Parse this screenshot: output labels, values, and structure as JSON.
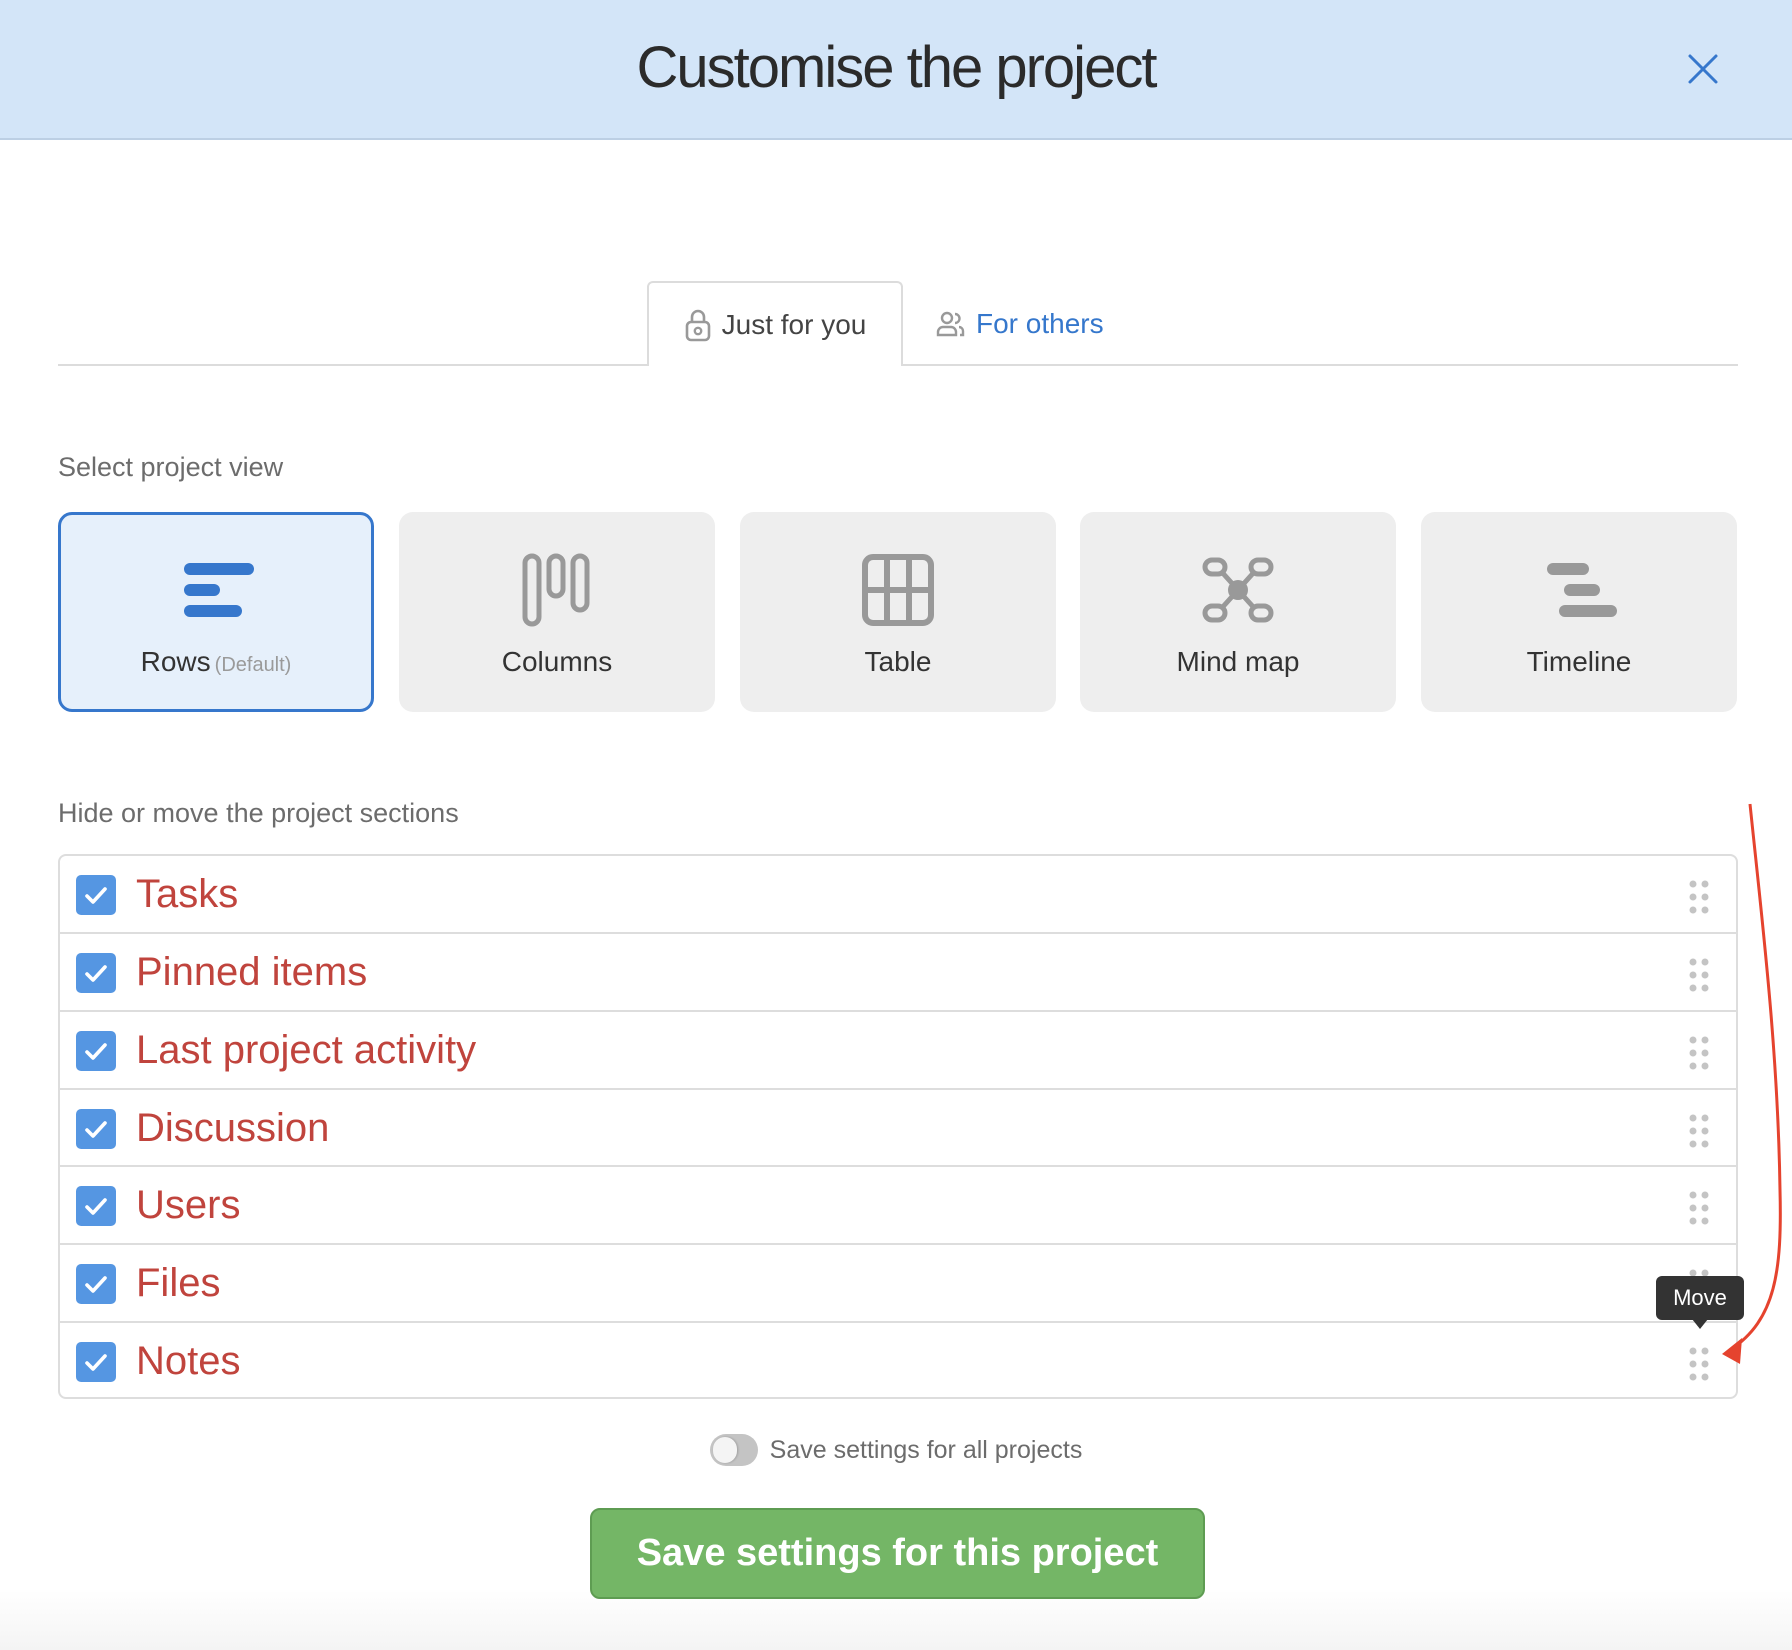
{
  "header": {
    "title": "Customise the project",
    "close_icon": "close-icon"
  },
  "tabs": [
    {
      "label": "Just for you",
      "icon": "lock-icon",
      "active": true
    },
    {
      "label": "For others",
      "icon": "users-icon",
      "active": false
    }
  ],
  "view_section": {
    "label": "Select project view",
    "views": [
      {
        "name": "Rows",
        "sub": "(Default)",
        "icon": "rows-icon",
        "selected": true
      },
      {
        "name": "Columns",
        "sub": "",
        "icon": "columns-icon",
        "selected": false
      },
      {
        "name": "Table",
        "sub": "",
        "icon": "table-icon",
        "selected": false
      },
      {
        "name": "Mind map",
        "sub": "",
        "icon": "mind-map-icon",
        "selected": false
      },
      {
        "name": "Timeline",
        "sub": "",
        "icon": "timeline-icon",
        "selected": false
      }
    ]
  },
  "sections_section": {
    "label": "Hide or move the project sections",
    "items": [
      {
        "name": "Tasks",
        "checked": true
      },
      {
        "name": "Pinned items",
        "checked": true
      },
      {
        "name": "Last project activity",
        "checked": true
      },
      {
        "name": "Discussion",
        "checked": true
      },
      {
        "name": "Users",
        "checked": true
      },
      {
        "name": "Files",
        "checked": true
      },
      {
        "name": "Notes",
        "checked": true
      }
    ],
    "tooltip": "Move"
  },
  "footer": {
    "toggle_label": "Save settings for all projects",
    "toggle_on": false,
    "save_button": "Save settings for this project"
  },
  "colors": {
    "header_bg": "#d3e5f8",
    "accent_blue": "#3677cc",
    "section_text": "#c0443d",
    "checkbox": "#5596e2",
    "save_green": "#74b666",
    "annotation_arrow": "#e5432e"
  }
}
